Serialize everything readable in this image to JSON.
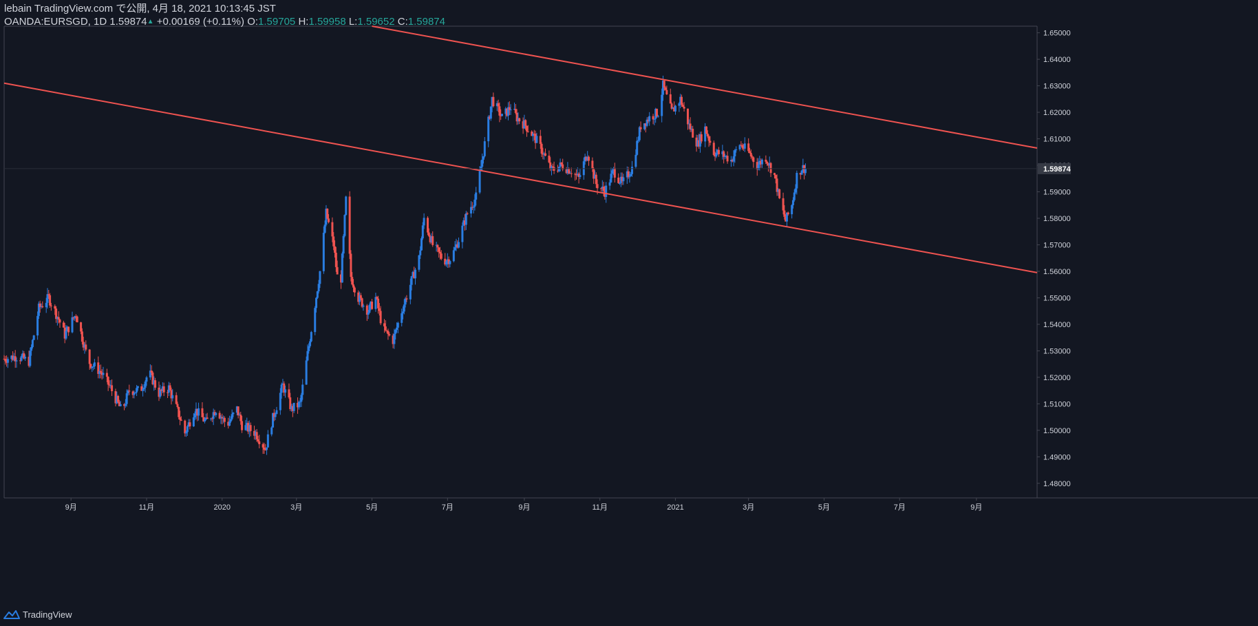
{
  "header": {
    "line1": "lebain TradingView.com で公開, 4月 18, 2021 10:13:45 JST",
    "symbol": "OANDA:EURSGD, 1D",
    "last": "1.59874",
    "change": "+0.00169 (+0.11%)",
    "o_label": "O:",
    "o_value": "1.59705",
    "h_label": "H:",
    "h_value": "1.59958",
    "l_label": "L:",
    "l_value": "1.59652",
    "c_label": "C:",
    "c_value": "1.59874"
  },
  "footer": {
    "brand": "TradingView"
  },
  "colors": {
    "background": "#131722",
    "up": "#2a7de1",
    "down": "#ef5350",
    "trendline": "#ef5350",
    "axis_text": "#d1d4dc",
    "border": "#434651",
    "price_tag": "#363a45"
  },
  "chart_data": {
    "type": "candlestick",
    "symbol": "OANDA:EURSGD",
    "interval": "1D",
    "y_axis": {
      "range": [
        1.4745,
        1.6525
      ],
      "ticks": [
        "1.48000",
        "1.49000",
        "1.50000",
        "1.51000",
        "1.52000",
        "1.53000",
        "1.54000",
        "1.55000",
        "1.56000",
        "1.57000",
        "1.58000",
        "1.59000",
        "1.60000",
        "1.61000",
        "1.62000",
        "1.63000",
        "1.64000",
        "1.65000"
      ],
      "current_price_label": "1.59874",
      "current_price": 1.59874
    },
    "x_axis": {
      "range": [
        "2019-07-09",
        "2021-10-20"
      ],
      "ticks": [
        {
          "label": "9月",
          "date": "2019-09-01"
        },
        {
          "label": "11月",
          "date": "2019-11-01"
        },
        {
          "label": "2020",
          "date": "2020-01-01"
        },
        {
          "label": "3月",
          "date": "2020-03-01"
        },
        {
          "label": "5月",
          "date": "2020-05-01"
        },
        {
          "label": "7月",
          "date": "2020-07-01"
        },
        {
          "label": "9月",
          "date": "2020-09-01"
        },
        {
          "label": "11月",
          "date": "2020-11-01"
        },
        {
          "label": "2021",
          "date": "2021-01-01"
        },
        {
          "label": "3月",
          "date": "2021-03-01"
        },
        {
          "label": "5月",
          "date": "2021-05-01"
        },
        {
          "label": "7月",
          "date": "2021-07-01"
        },
        {
          "label": "9月",
          "date": "2021-09-01"
        }
      ]
    },
    "close_series": [
      [
        "2019-07-09",
        1.527
      ],
      [
        "2019-07-20",
        1.528
      ],
      [
        "2019-07-29",
        1.526
      ],
      [
        "2019-08-06",
        1.546
      ],
      [
        "2019-08-14",
        1.55
      ],
      [
        "2019-08-22",
        1.542
      ],
      [
        "2019-08-27",
        1.536
      ],
      [
        "2019-09-05",
        1.544
      ],
      [
        "2019-09-15",
        1.526
      ],
      [
        "2019-09-25",
        1.522
      ],
      [
        "2019-10-03",
        1.516
      ],
      [
        "2019-10-12",
        1.507
      ],
      [
        "2019-10-18",
        1.515
      ],
      [
        "2019-10-27",
        1.515
      ],
      [
        "2019-11-03",
        1.522
      ],
      [
        "2019-11-11",
        1.514
      ],
      [
        "2019-11-19",
        1.516
      ],
      [
        "2019-11-27",
        1.506
      ],
      [
        "2019-12-02",
        1.499
      ],
      [
        "2019-12-10",
        1.508
      ],
      [
        "2019-12-19",
        1.503
      ],
      [
        "2019-12-27",
        1.508
      ],
      [
        "2020-01-05",
        1.502
      ],
      [
        "2020-01-13",
        1.508
      ],
      [
        "2020-01-17",
        1.502
      ],
      [
        "2020-01-28",
        1.499
      ],
      [
        "2020-02-05",
        1.493
      ],
      [
        "2020-02-10",
        1.503
      ],
      [
        "2020-02-19",
        1.517
      ],
      [
        "2020-02-26",
        1.508
      ],
      [
        "2020-03-04",
        1.51
      ],
      [
        "2020-03-12",
        1.535
      ],
      [
        "2020-03-20",
        1.56
      ],
      [
        "2020-03-25",
        1.582
      ],
      [
        "2020-03-31",
        1.57
      ],
      [
        "2020-04-05",
        1.55
      ],
      [
        "2020-04-10",
        1.587
      ],
      [
        "2020-04-14",
        1.558
      ],
      [
        "2020-04-20",
        1.55
      ],
      [
        "2020-04-28",
        1.545
      ],
      [
        "2020-05-04",
        1.55
      ],
      [
        "2020-05-10",
        1.538
      ],
      [
        "2020-05-18",
        1.534
      ],
      [
        "2020-05-25",
        1.545
      ],
      [
        "2020-06-01",
        1.555
      ],
      [
        "2020-06-08",
        1.565
      ],
      [
        "2020-06-12",
        1.58
      ],
      [
        "2020-06-19",
        1.57
      ],
      [
        "2020-06-28",
        1.564
      ],
      [
        "2020-07-04",
        1.565
      ],
      [
        "2020-07-10",
        1.572
      ],
      [
        "2020-07-17",
        1.582
      ],
      [
        "2020-07-24",
        1.588
      ],
      [
        "2020-07-31",
        1.608
      ],
      [
        "2020-08-06",
        1.625
      ],
      [
        "2020-08-14",
        1.618
      ],
      [
        "2020-08-21",
        1.622
      ],
      [
        "2020-08-26",
        1.618
      ],
      [
        "2020-09-02",
        1.615
      ],
      [
        "2020-09-10",
        1.61
      ],
      [
        "2020-09-16",
        1.605
      ],
      [
        "2020-09-23",
        1.598
      ],
      [
        "2020-10-01",
        1.6
      ],
      [
        "2020-10-09",
        1.598
      ],
      [
        "2020-10-15",
        1.595
      ],
      [
        "2020-10-22",
        1.605
      ],
      [
        "2020-10-29",
        1.593
      ],
      [
        "2020-11-05",
        1.59
      ],
      [
        "2020-11-12",
        1.598
      ],
      [
        "2020-11-19",
        1.593
      ],
      [
        "2020-11-27",
        1.599
      ],
      [
        "2020-12-04",
        1.615
      ],
      [
        "2020-12-11",
        1.618
      ],
      [
        "2020-12-18",
        1.62
      ],
      [
        "2020-12-22",
        1.63
      ],
      [
        "2020-12-29",
        1.62
      ],
      [
        "2021-01-05",
        1.625
      ],
      [
        "2021-01-12",
        1.615
      ],
      [
        "2021-01-19",
        1.608
      ],
      [
        "2021-01-25",
        1.614
      ],
      [
        "2021-02-01",
        1.605
      ],
      [
        "2021-02-08",
        1.604
      ],
      [
        "2021-02-15",
        1.602
      ],
      [
        "2021-02-22",
        1.608
      ],
      [
        "2021-03-01",
        1.605
      ],
      [
        "2021-03-08",
        1.6
      ],
      [
        "2021-03-15",
        1.603
      ],
      [
        "2021-03-22",
        1.596
      ],
      [
        "2021-03-26",
        1.587
      ],
      [
        "2021-03-31",
        1.579
      ],
      [
        "2021-04-05",
        1.585
      ],
      [
        "2021-04-09",
        1.596
      ],
      [
        "2021-04-13",
        1.599
      ],
      [
        "2021-04-18",
        1.5987
      ]
    ],
    "trendlines": [
      {
        "start": {
          "date": "2019-07-09",
          "price": 1.631
        },
        "end": {
          "date": "2021-10-20",
          "price": 1.5595
        }
      },
      {
        "start": {
          "date": "2020-05-01",
          "price": 1.6525
        },
        "end": {
          "date": "2021-10-20",
          "price": 1.6065
        }
      }
    ],
    "grid": false
  }
}
